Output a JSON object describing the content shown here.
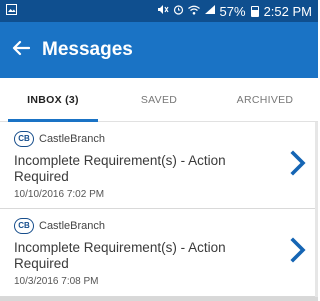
{
  "status_bar": {
    "battery": "57%",
    "time": "2:52 PM",
    "icons": [
      "gallery-icon",
      "mute-icon",
      "alarm-icon",
      "wifi-icon",
      "signal-icon",
      "battery-icon"
    ]
  },
  "app_bar": {
    "back_icon": "back-arrow-icon",
    "title": "Messages"
  },
  "tabs": [
    {
      "label": "INBOX (3)",
      "active": true
    },
    {
      "label": "SAVED",
      "active": false
    },
    {
      "label": "ARCHIVED",
      "active": false
    }
  ],
  "messages": [
    {
      "sender_logo": "CB",
      "sender": "CastleBranch",
      "subject": "Incomplete Requirement(s) - Action Required",
      "date": "10/10/2016 7:02 PM"
    },
    {
      "sender_logo": "CB",
      "sender": "CastleBranch",
      "subject": "Incomplete Requirement(s) - Action Required",
      "date": "10/3/2016 7:08 PM"
    }
  ],
  "colors": {
    "status_bar": "#0f4f8f",
    "app_bar": "#1a73c5",
    "accent": "#1a73c5",
    "chevron": "#1565b4"
  }
}
